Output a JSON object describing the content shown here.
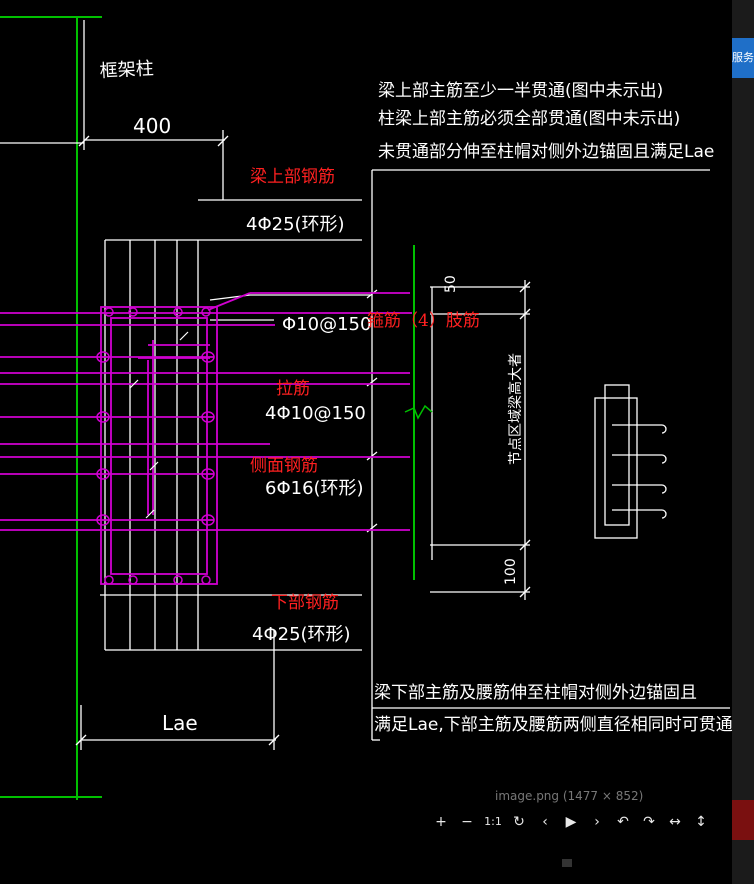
{
  "cad": {
    "labels": {
      "column": "框架柱",
      "dim_400": "400",
      "dim_lae": "Lae",
      "dim_50": "50",
      "dim_100": "100",
      "vertical_note": "节点区域梁高大者",
      "stirrup_spec": "Φ10@150",
      "top_bar_spec": "4Φ25(环形)",
      "tie_spec": "4Φ10@150",
      "side_spec": "6Φ16(环形)",
      "bottom_bar_spec": "4Φ25(环形)"
    },
    "notes_top": [
      "梁上部主筋至少一半贯通(图中未示出)",
      "柱梁上部主筋必须全部贯通(图中未示出)",
      "未贯通部分伸至柱帽对侧外边锚固且满足Lae"
    ],
    "notes_bottom": [
      "梁下部主筋及腰筋伸至柱帽对侧外边锚固且",
      "满足Lae,下部主筋及腰筋两侧直径相同时可贯通"
    ],
    "red_labels": {
      "top_rebar": "梁上部钢筋",
      "stirrup": "箍筋（4）肢筋",
      "tie": "拉筋",
      "side_rebar": "侧面钢筋",
      "bottom_rebar": "下部钢筋"
    },
    "colors": {
      "white": "#ffffff",
      "magenta": "#d000d0",
      "green": "#00c000",
      "red": "#ff2020",
      "background": "#000000"
    }
  },
  "viewer": {
    "caption": "image.png (1477 × 852)",
    "side_button": "服务",
    "toolbar": [
      {
        "name": "zoom-in-button",
        "glyph": "+"
      },
      {
        "name": "zoom-out-button",
        "glyph": "−"
      },
      {
        "name": "actual-size-button",
        "glyph": "1:1"
      },
      {
        "name": "reset-button",
        "glyph": "↻"
      },
      {
        "name": "prev-button",
        "glyph": "‹"
      },
      {
        "name": "play-button",
        "glyph": "▶"
      },
      {
        "name": "next-button",
        "glyph": "›"
      },
      {
        "name": "rotate-left-button",
        "glyph": "↶"
      },
      {
        "name": "rotate-right-button",
        "glyph": "↷"
      },
      {
        "name": "flip-horizontal-button",
        "glyph": "↔"
      },
      {
        "name": "flip-vertical-button",
        "glyph": "↕"
      }
    ]
  }
}
